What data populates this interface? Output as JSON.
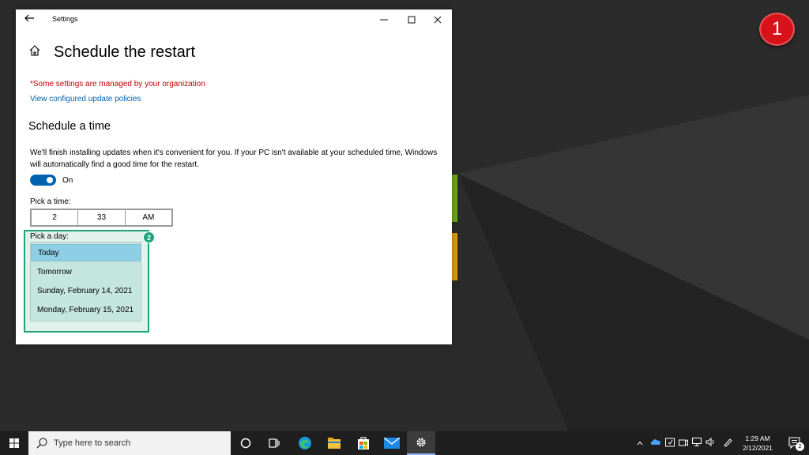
{
  "window": {
    "title": "Settings",
    "page_title": "Schedule the restart",
    "org_message": "*Some settings are managed by your organization",
    "policy_link": "View configured update policies",
    "section_title": "Schedule a time",
    "description": "We'll finish installing updates when it's convenient for you. If your PC isn't available at your scheduled time, Windows will automatically find a good time for the restart.",
    "toggle": {
      "state": "On",
      "on": true
    },
    "pick_time": {
      "label": "Pick a time:",
      "hour": "2",
      "minute": "33",
      "period": "AM"
    },
    "pick_day": {
      "label": "Pick a day:",
      "options": [
        "Today",
        "Tomorrow",
        "Sunday, February 14, 2021",
        "Monday, February 15, 2021"
      ],
      "selected": "Today"
    }
  },
  "annotations": {
    "step1": "1",
    "step2": "2"
  },
  "taskbar": {
    "search_placeholder": "Type here to search",
    "time": "1:29 AM",
    "date": "2/12/2021",
    "notification_count": "2",
    "pinned": [
      "task-view",
      "edge",
      "file-explorer",
      "store",
      "mail",
      "settings"
    ]
  },
  "colors": {
    "accent": "#0063b1",
    "warning": "#c50000",
    "highlight": "#1fa37a",
    "badge_red": "#d7121a"
  }
}
